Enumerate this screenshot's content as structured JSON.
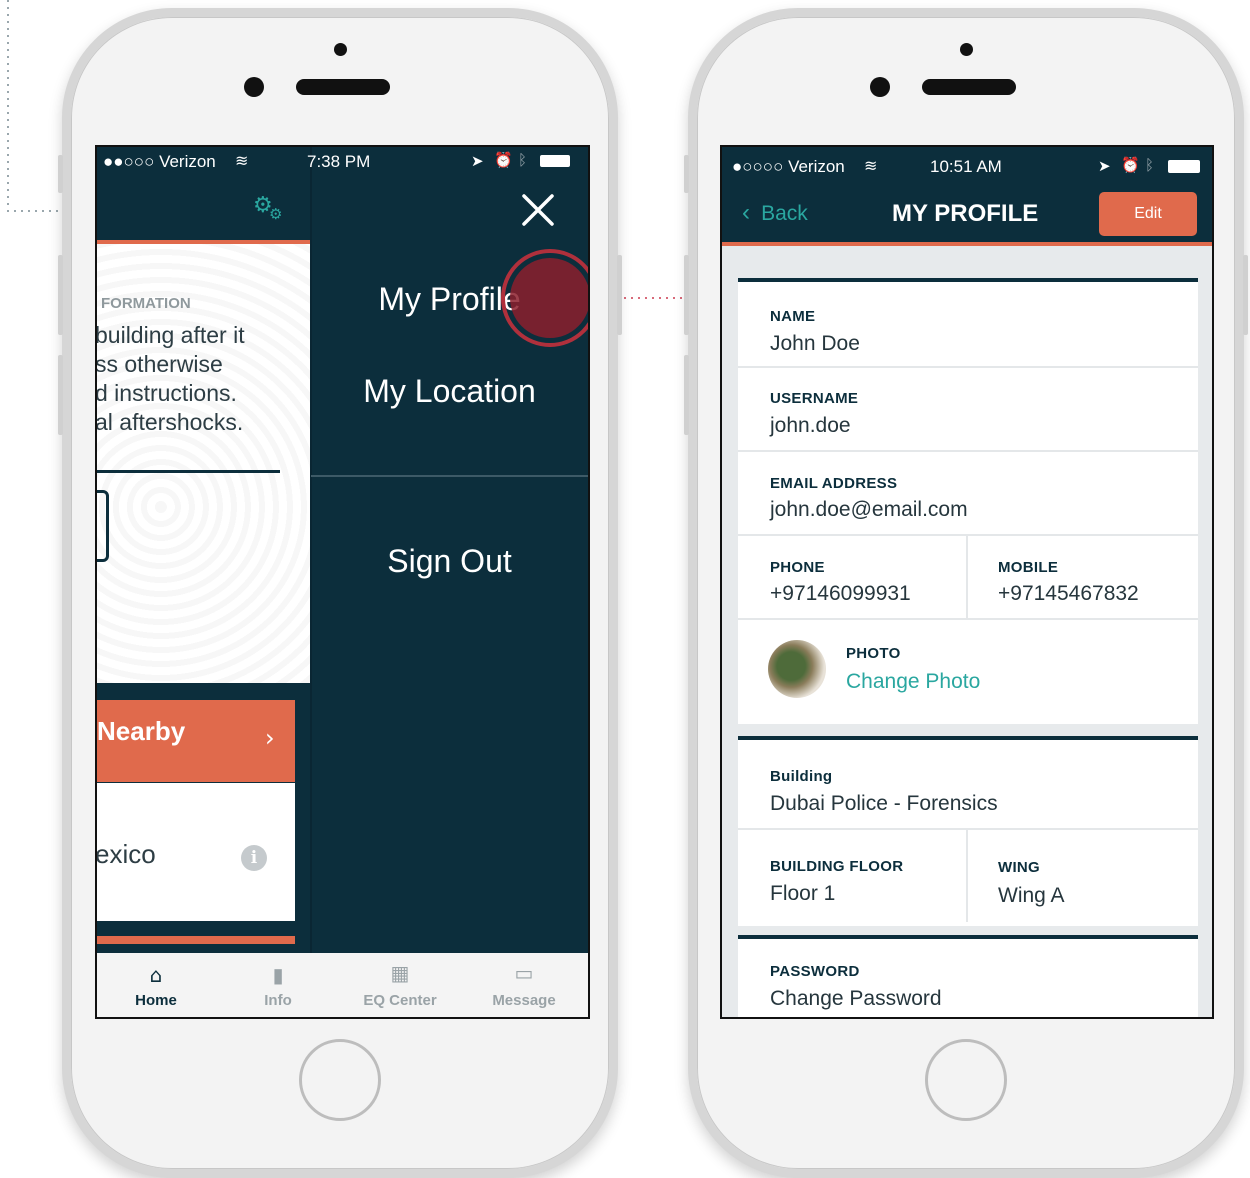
{
  "left_phone": {
    "status": {
      "carrier": "●●○○○ Verizon",
      "time": "7:38 PM"
    },
    "menu": {
      "close_icon": "close-icon",
      "items": [
        "My Profile",
        "My Location",
        "Sign Out"
      ]
    },
    "background": {
      "section_label": "FORMATION",
      "body_lines": [
        "building after it",
        "ss otherwise",
        "d instructions.",
        "al aftershocks."
      ],
      "nearby_label": "Nearby",
      "list_item": "exico"
    },
    "tabs": [
      {
        "label": "Home",
        "icon": "home-icon"
      },
      {
        "label": "Info",
        "icon": "info-icon"
      },
      {
        "label": "EQ Center",
        "icon": "building-icon"
      },
      {
        "label": "Message",
        "icon": "message-icon"
      }
    ]
  },
  "right_phone": {
    "status": {
      "carrier": "●○○○○ Verizon",
      "time": "10:51 AM"
    },
    "header": {
      "back_label": "Back",
      "title": "MY PROFILE",
      "edit_label": "Edit"
    },
    "profile": {
      "name_label": "NAME",
      "name_value": "John Doe",
      "username_label": "USERNAME",
      "username_value": "john.doe",
      "email_label": "EMAIL ADDRESS",
      "email_value": "john.doe@email.com",
      "phone_label": "PHONE",
      "phone_value": "+97146099931",
      "mobile_label": "MOBILE",
      "mobile_value": "+97145467832",
      "photo_label": "PHOTO",
      "photo_action": "Change Photo"
    },
    "location": {
      "building_label": "Building",
      "building_value": "Dubai Police - Forensics",
      "floor_label": "BUILDING FLOOR",
      "floor_value": "Floor 1",
      "wing_label": "WING",
      "wing_value": "Wing A"
    },
    "security": {
      "password_label": "PASSWORD",
      "password_action": "Change Password"
    }
  },
  "colors": {
    "navy": "#0c2e3c",
    "orange": "#e06a4c",
    "teal": "#2aa7a0",
    "callout_red": "#b0303c"
  }
}
